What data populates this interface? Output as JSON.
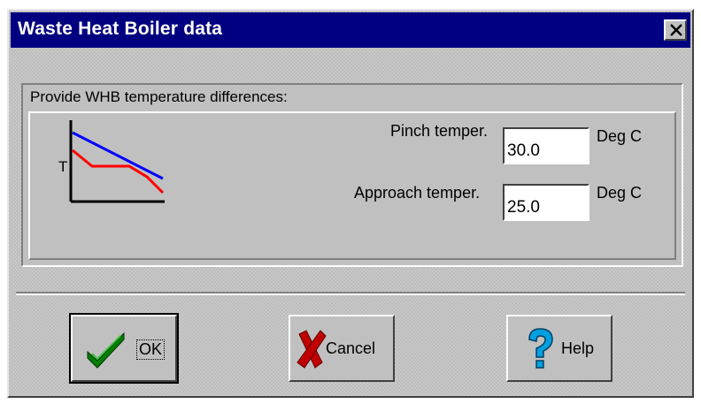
{
  "window": {
    "title": "Waste Heat Boiler data",
    "close_icon": "close-icon"
  },
  "group": {
    "title": "Provide WHB temperature differences:",
    "diagram": {
      "axis_label": "T",
      "hot_line_color": "#0000ff",
      "cold_line_color": "#ff0000"
    }
  },
  "fields": {
    "pinch": {
      "label": "Pinch temper.",
      "value": "30.0",
      "unit": "Deg C"
    },
    "approach": {
      "label": "Approach temper.",
      "value": "25.0",
      "unit": "Deg C"
    }
  },
  "buttons": {
    "ok": {
      "label": "OK",
      "icon": "checkmark-icon"
    },
    "cancel": {
      "label": "Cancel",
      "icon": "x-cross-icon"
    },
    "help": {
      "label": "Help",
      "icon": "question-mark-icon"
    }
  }
}
